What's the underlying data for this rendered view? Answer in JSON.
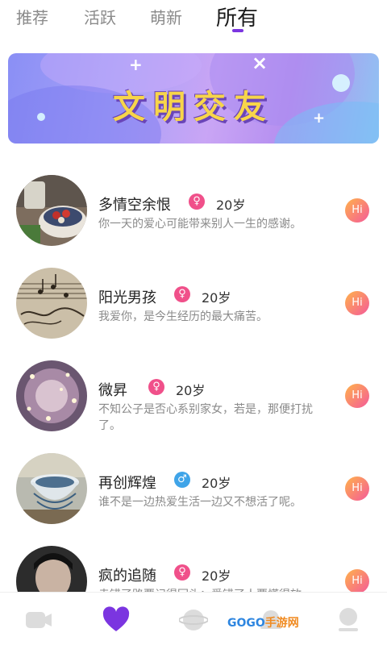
{
  "tabs": [
    {
      "label": "推荐"
    },
    {
      "label": "活跃"
    },
    {
      "label": "萌新"
    },
    {
      "label": "所有",
      "active": true
    }
  ],
  "banner": {
    "title": "文明交友"
  },
  "users": [
    {
      "name": "多情空余恨",
      "gender": "female",
      "gender_symbol": "♀",
      "age": "20岁",
      "desc": "你一天的爱心可能带来别人一生的感谢。",
      "hi": "Hi",
      "avatar_icon": "food-bowl-photo"
    },
    {
      "name": "阳光男孩",
      "gender": "female",
      "gender_symbol": "♀",
      "age": "20岁",
      "desc": "我爱你，是今生经历的最大痛苦。",
      "hi": "Hi",
      "avatar_icon": "sheet-music-photo"
    },
    {
      "name": "微昇",
      "gender": "female",
      "gender_symbol": "♀",
      "age": "20岁",
      "desc": "不知公子是否心系别家女，若是，那便打扰了。",
      "hi": "Hi",
      "avatar_icon": "fairy-lights-photo"
    },
    {
      "name": "再创辉煌",
      "gender": "male",
      "gender_symbol": "♂",
      "age": "20岁",
      "desc": "谁不是一边热爱生活一边又不想活了呢。",
      "hi": "Hi",
      "avatar_icon": "stacked-bowls-photo"
    },
    {
      "name": "疯的追随",
      "gender": "female",
      "gender_symbol": "♀",
      "age": "20岁",
      "desc": "走错了路要记得回头；爱错了人要懂得放",
      "hi": "Hi",
      "avatar_icon": "portrait-photo"
    }
  ],
  "bottom_nav": [
    {
      "icon": "video-icon"
    },
    {
      "icon": "heart-icon",
      "active": true
    },
    {
      "icon": "planet-icon"
    },
    {
      "icon": "bell-icon"
    },
    {
      "icon": "profile-icon"
    }
  ],
  "watermark": {
    "text": "GOGO",
    "suffix": "手游网"
  },
  "colors": {
    "accent": "#7b35e0",
    "female": "#f0508a",
    "male": "#3fa4e8",
    "hi_start": "#ffb24a",
    "hi_end": "#f45a9a"
  }
}
